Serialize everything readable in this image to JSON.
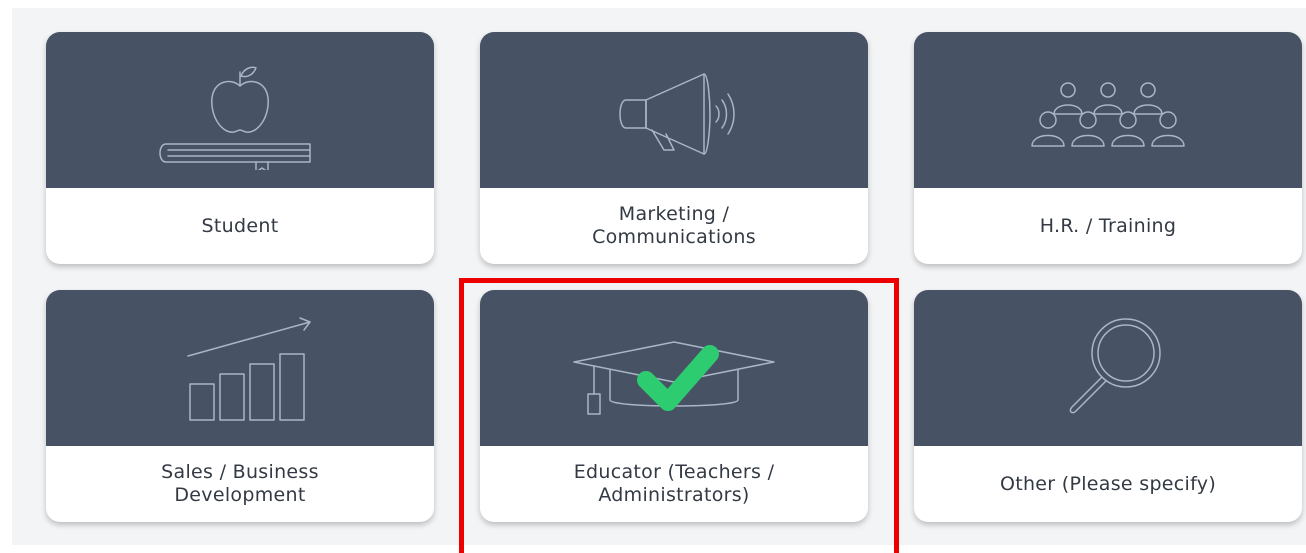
{
  "cards": [
    {
      "label": "Student",
      "icon": "apple-book-icon"
    },
    {
      "label": "Marketing /\nCommunications",
      "icon": "megaphone-icon"
    },
    {
      "label": "H.R. / Training",
      "icon": "people-group-icon"
    },
    {
      "label": "Sales / Business\nDevelopment",
      "icon": "growth-chart-icon"
    },
    {
      "label": "Educator (Teachers /\nAdministrators)",
      "icon": "graduation-cap-icon",
      "selected": true
    },
    {
      "label": "Other (Please specify)",
      "icon": "magnifier-icon"
    }
  ],
  "colors": {
    "card_top": "#475264",
    "icon_stroke": "#a9b6c8",
    "check": "#2ecc71",
    "highlight": "#ee0000"
  }
}
